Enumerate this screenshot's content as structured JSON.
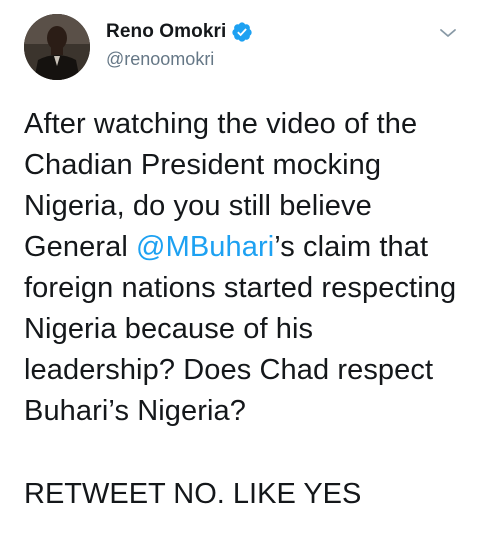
{
  "author": {
    "display_name": "Reno Omokri",
    "handle": "@renoomokri",
    "verified": true
  },
  "tweet": {
    "text_before_mention": "After watching the video of the Chadian President mocking Nigeria, do you still believe General ",
    "mention": "@MBuhari",
    "text_after_mention": "’s claim that foreign nations started respecting Nigeria because of his leadership? Does Chad respect Buhari’s Nigeria?",
    "call_to_action": "RETWEET NO. LIKE YES"
  },
  "icons": {
    "verified": "verified-badge-icon",
    "menu": "chevron-down-icon"
  },
  "colors": {
    "text": "#14171a",
    "secondary": "#657786",
    "link": "#1da1f2"
  }
}
